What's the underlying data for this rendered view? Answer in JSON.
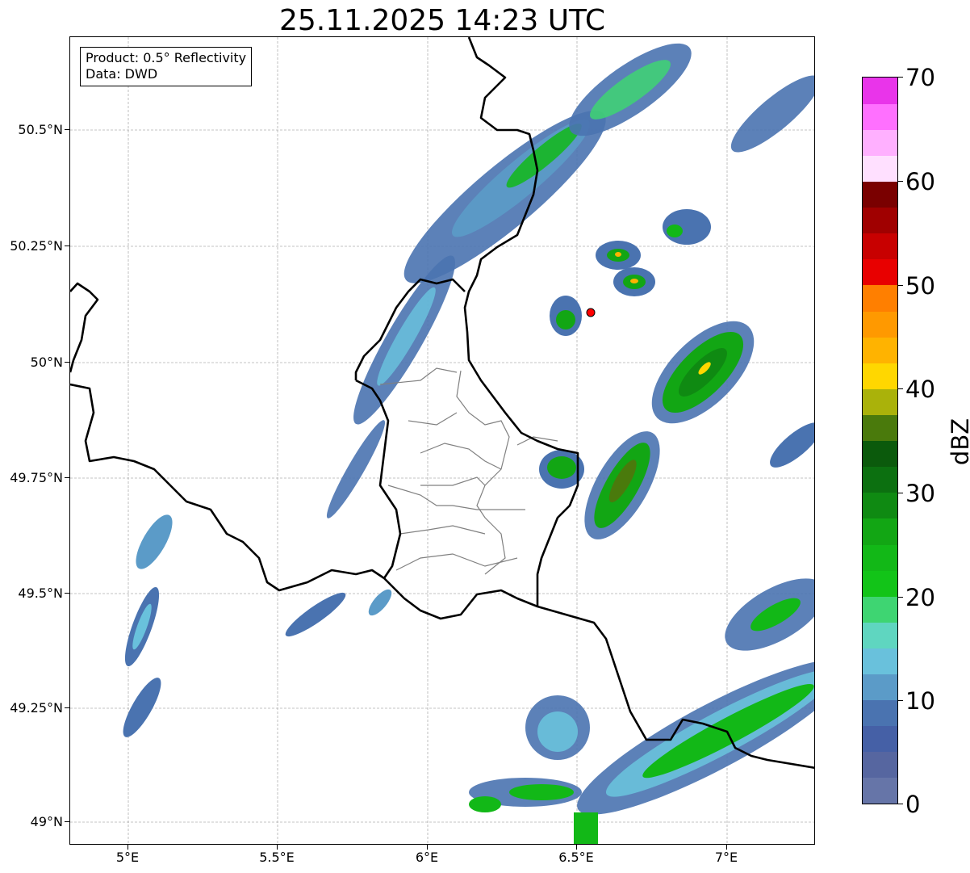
{
  "title": "25.11.2025 14:23 UTC",
  "info": {
    "product": "Product: 0.5° Reflectivity",
    "data": "Data: DWD"
  },
  "axes": {
    "lat_labels": [
      "50.5°N",
      "50.25°N",
      "50°N",
      "49.75°N",
      "49.5°N",
      "49.25°N",
      "49°N"
    ],
    "lon_labels": [
      "5°E",
      "5.5°E",
      "6°E",
      "6.5°E",
      "7°E"
    ],
    "lat_range": [
      48.95,
      50.7
    ],
    "lon_range": [
      4.8,
      7.3
    ],
    "grid": true
  },
  "colorbar": {
    "label": "dBZ",
    "tick_labels": [
      "70",
      "60",
      "50",
      "40",
      "30",
      "20",
      "10",
      "0"
    ],
    "range": [
      0,
      70
    ],
    "colors": [
      "#6675a8",
      "#5666a0",
      "#4560a6",
      "#4a73b0",
      "#5b9bc8",
      "#69c1dc",
      "#5fd6c0",
      "#3ed572",
      "#12c418",
      "#12b817",
      "#12a614",
      "#0f8a12",
      "#0c7010",
      "#0b5a0c",
      "#4a7a0c",
      "#aab20a",
      "#ffd700",
      "#ffb300",
      "#ff9900",
      "#ff7f00",
      "#e80000",
      "#c80000",
      "#a00000",
      "#7a0000",
      "#ffe0ff",
      "#ffb0ff",
      "#ff70ff",
      "#e934ea"
    ]
  },
  "colors": {
    "border": "#000000",
    "admin_border": "#808080",
    "grid": "#b0b0b0",
    "radar_site": "#ff0000"
  },
  "radar_site": {
    "lon": 6.55,
    "lat": 50.11
  }
}
